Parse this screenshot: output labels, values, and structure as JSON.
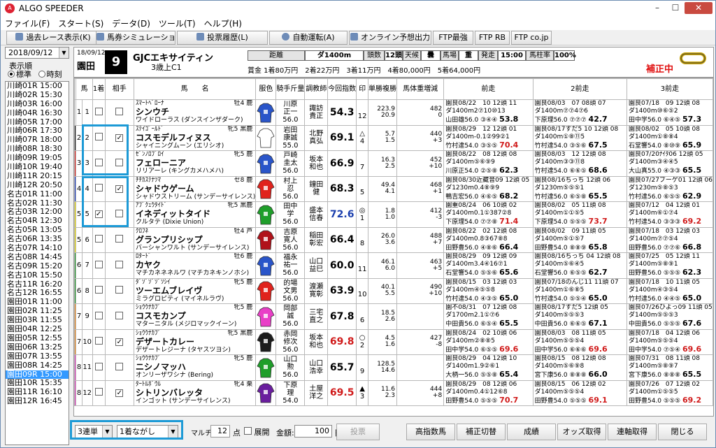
{
  "window": {
    "title": "ALGO SPEEDER",
    "min": "–",
    "max": "☐",
    "close": "✕"
  },
  "menu": [
    "ファイル(F)",
    "スタート(S)",
    "データ(D)",
    "ツール(T)",
    "ヘルプ(H)"
  ],
  "toolbar": [
    "過去レース表示(K)",
    "馬券シミュレーション(B)",
    "投票履歴(L)",
    "自動運転(A)",
    "オンライン予想出力",
    "FTP最強",
    "FTP RB",
    "FTP co.jp"
  ],
  "left": {
    "date": "2018/09/12",
    "order_label": "表示順",
    "opt_std": "標準",
    "opt_time": "時刻",
    "races": [
      "川崎01R 15:00",
      "川崎02R 15:30",
      "川崎03R 16:00",
      "川崎04R 16:30",
      "川崎05R 17:00",
      "川崎06R 17:30",
      "川崎07R 18:00",
      "川崎08R 18:30",
      "川崎09R 19:05",
      "川崎10R 19:40",
      "川崎11R 20:15",
      "川崎12R 20:50",
      "名古01R 11:00",
      "名古02R 11:30",
      "名古03R 12:00",
      "名古04R 12:30",
      "名古05R 13:05",
      "名古06R 13:35",
      "名古07R 14:10",
      "名古08R 14:45",
      "名古09R 15:20",
      "名古10R 15:50",
      "名古11R 16:20",
      "名古12R 16:55",
      "園田01R 11:00",
      "園田02R 11:25",
      "園田03R 11:55",
      "園田04R 12:25",
      "園田05R 12:55",
      "園田06R 13:25",
      "園田07R 13:55",
      "園田08R 14:25",
      "園田09R 15:00",
      "園田10R 15:35",
      "園田11R 16:10",
      "園田12R 16:45"
    ],
    "selected": 32
  },
  "race": {
    "date": "18/09/12",
    "course": "園田",
    "num": "9",
    "name": "GJCエキサイティン",
    "cls": "3歳上C1",
    "dist_lbl": "距離",
    "dist": "ダ1400m",
    "heads_lbl": "頭数",
    "heads": "12頭",
    "weather_lbl": "天候",
    "weather": "曇",
    "track_lbl": "馬場",
    "track": "重",
    "start_lbl": "発走",
    "start": "15:00",
    "rate_lbl": "馬柱率",
    "rate": "100%",
    "prize": "賞金 1着80万円　2着22万円　3着11万円　4着80,000円　5着64,000円",
    "hosei": "補正中"
  },
  "cols": [
    "馬",
    "1着",
    "相手",
    "馬　　名",
    "服色",
    "騎手斤量",
    "調教師",
    "今回指数",
    "印",
    "単勝複勝",
    "馬体重増減",
    "前走",
    "2前走",
    "3前走"
  ],
  "horses": [
    {
      "n": "1",
      "w": "1",
      "c1": "",
      "c2": "",
      "sire": "ｽﾏｰﾄﾍﾞﾛｰﾅ",
      "age": "牡4 鹿",
      "name": "シンウチ",
      "dam": "ワイドローラス (ダンスインザダーク)",
      "jk": "川原\n正一\n56.0",
      "tr": "諏訪\n貴正",
      "idx": "54.3",
      "ic": "#000",
      "mk": "\n12",
      "odds": "223.9\n20.9",
      "wt": "482\n0",
      "p1a": "園良08/22　10 12頭 11",
      "p1b": "ダ1400m2⑦10⑩13",
      "p1c": "山田雄56.0 ③④④ 53.8",
      "p2a": "園良08/03　07 08頭 07",
      "p2b": "ダ1400m⑦⑦4⑦6",
      "p2c": "下原理56.0 ⑦⑦⑦ 42.7",
      "p3a": "園良07/18　09 12頭 08",
      "p3b": "ダ1400m⑩⑥⑤2",
      "p3c": "田中学56.0 ⑥④⑤ 57.3"
    },
    {
      "n": "2",
      "w": "2",
      "c1": "",
      "c2": "✓",
      "sire": "ｽﾃｲｺﾞｰﾙﾄﾞ",
      "age": "牝5 黒鹿",
      "name": "コスモデルフィヌス",
      "dam": "シャイニングムーン (エリシオ)",
      "jk": "岩田\n康誠\n55.0",
      "tr": "北野\n真弘",
      "idx": "69.1",
      "ic": "#000",
      "mk": "△\n4",
      "odds": "5.7\n1.5",
      "wt": "440\n+3",
      "p1a": "園良08/29　12 12頭 01",
      "p1b": "ダ1400m-0.1②99②1",
      "p1c": "竹村達54.0 ③⑤⑤ 70.4",
      "p2a": "園良08/17すだ5 10 12頭 08",
      "p2b": "ダ1400m①⑧⑪5",
      "p2c": "竹村達54.0 ③⑤⑥ 67.5",
      "p3a": "園良08/02　05 10頭 08",
      "p3b": "ダ1400m①⑧⑧4",
      "p3c": "石堂響54.0 ⑧⑩⑨ 65.9"
    },
    {
      "n": "3",
      "w": "3",
      "c1": "",
      "c2": "",
      "sire": "ｾﾞﾝﾉﾛﾌﾞﾛｲ",
      "age": "牝5 鹿",
      "name": "フェローニア",
      "dam": "リリアーレ (キングカメハメハ)",
      "jk": "戸崎\n圭太\n56.0",
      "tr": "坂本\n和也",
      "idx": "66.9",
      "ic": "#000",
      "mk": "\n7",
      "odds": "16.3\n2.5",
      "wt": "452\n+10",
      "p1a": "園良08/22　08 12頭 08",
      "p1b": "ダ1400m⑤⑥⑨9",
      "p1c": "川原正54.0 ②⑤⑧ 62.3",
      "p2a": "園良08/03　12 12頭 08",
      "p2b": "ダ1400m③③⑪8",
      "p2c": "竹村達54.0 ⑥⑥⑤ 68.6",
      "p3a": "園良07/20ﾅｲﾀ06 12頭 05",
      "p3b": "ダ1400m③④④5",
      "p3c": "大山真55.0 ④③③ 65.5"
    },
    {
      "n": "4",
      "w": "4",
      "c1": "",
      "c2": "✓",
      "sire": "ﾁﾁｶｽﾃﾅﾂﾏ",
      "age": "セ8 鹿",
      "name": "シャドウゲーム",
      "dam": "シャドウストリーム (サンデーサイレンス)",
      "jk": "村上\n忍\n56.0",
      "tr": "鐘田\n健",
      "idx": "68.3",
      "ic": "#000",
      "mk": "\n5",
      "odds": "49.4\n4.1",
      "wt": "468\n+1",
      "p1a": "園良08/30近藏音09 12頭 05",
      "p1b": "ダ1230m0.4⑧⑨9",
      "p1c": "鴨吉宏56.0 ④⑥⑤ 68.2",
      "p2a": "園良08/16ちっち 12頭 06",
      "p2b": "ダ1230m⑤⑤⑤1",
      "p2c": "竹村達56.0 ⑥⑤⑧ 65.5",
      "p3a": "園良07/27ブーゲ01 12頭 06",
      "p3b": "ダ1230m⑤⑧⑤3",
      "p3c": "竹村達56.0 ⑥⑤⑤ 62.9"
    },
    {
      "n": "5",
      "w": "5",
      "c1": "✓",
      "c2": "",
      "sire": "ｱﾌﾞｸｪｳﾀｲﾄﾞ",
      "age": "牝5 黒鹿",
      "name": "イネディットタイド",
      "dam": "クルタテ (Dixie Union)",
      "jk": "田中\n学\n56.0",
      "tr": "盛本\n信春",
      "idx": "72.6",
      "ic": "#1b3fae",
      "mk": "◎\n1",
      "odds": "1.8\n1.0",
      "wt": "412\n-3",
      "p1a": "園重08/24　06 10頭 02",
      "p1b": "ダ1400m0.1①387②8",
      "p1c": "下原理54.0 ⑦⑦⑧ 71.4",
      "p2a": "園良08/02　05 11頭 08",
      "p2b": "ダ1400m①①⑤5",
      "p2c": "下原理54.0 ⑤⑤⑤ 73.7",
      "p3a": "園良07/12　04 12頭 01",
      "p3b": "ダ1400m⑥①⑦4",
      "p3c": "竹村達54.0 ③③③ 69.2"
    },
    {
      "n": "6",
      "w": "5",
      "c1": "",
      "c2": "",
      "sire": "ｸﾛﾌﾈ",
      "age": "牡4 芦",
      "name": "グランプリシップ",
      "dam": "バーシャンワルト (サンデーサイレンス)",
      "jk": "吉原\n寛人\n56.0",
      "tr": "稲田\n彰宏",
      "idx": "66.4",
      "ic": "#000",
      "mk": "\n8",
      "odds": "26.0\n3.6",
      "wt": "488\n+7",
      "p1a": "園良08/22　02 12頭 08",
      "p1b": "ダ1400m0.8③67⑧8",
      "p1c": "田野豊56.0 ④⑧⑥ 66.4",
      "p2a": "園良08/02　09 11頭 05",
      "p2b": "ダ1400m⑤①⑤7",
      "p2c": "田野豊54.0 ⑧⑧⑨ 65.8",
      "p3a": "園良07/18　03 12頭 03",
      "p3b": "ダ1400m⑦⑦⑤4",
      "p3c": "田野豊56.0 ⑦⑦⑥ 66.8"
    },
    {
      "n": "7",
      "w": "6",
      "c1": "",
      "c2": "",
      "sire": "ﾛﾀｰﾄﾞ",
      "age": "牡6 鹿",
      "name": "カヤク",
      "dam": "マチカネネネルワ (マチカネキンノホシ)",
      "jk": "福永\n祐一\n56.0",
      "tr": "山口\n益巳",
      "idx": "60.0",
      "ic": "#000",
      "mk": "\n11",
      "odds": "46.1\n6.0",
      "wt": "463\n+5",
      "p1a": "園良08/29　09 12頭 09",
      "p1b": "ダ1400m3.4④16⑦1",
      "p1c": "石堂響54.0 ⑤⑤⑥ 65.6",
      "p2a": "園良08/16ちっち 04 12頭 08",
      "p2b": "ダ1400m⑤⑥④5",
      "p2c": "石堂響56.0 ⑥⑤⑤ 62.7",
      "p3a": "園良07/25　05 12頭 11",
      "p3b": "ダ1400m⑤⑧⑨1",
      "p3c": "田野豊56.0 ⑤⑤⑤ 62.3"
    },
    {
      "n": "8",
      "w": "6",
      "c1": "",
      "c2": "",
      "sire": "ﾀﾞｿﾞｿﾞｿﾞｿｼｲ",
      "age": "牝5 鹿",
      "name": "ツーエムブレイヴ",
      "dam": "ミラグロピティ (マイネルラヴ)",
      "jk": "的場\n文男\n56.0",
      "tr": "渡瀬\n寛彰",
      "idx": "63.9",
      "ic": "#000",
      "mk": "\n10",
      "odds": "40.1\n5.5",
      "wt": "490\n+10",
      "p1a": "園良08/15　03 12頭 03",
      "p1b": "ダ1400m④⑤⑤8",
      "p1c": "竹村達54.0 ④③⑤ 65.0",
      "p2a": "園良07/18のんじ11 11頭 07",
      "p2b": "ダ1400m①⑥⑧5",
      "p2c": "竹村達54.0 ⑤⑤④ 65.0",
      "p3a": "園良07/18　10 11頭 05",
      "p3b": "ダ1400m④③⑤4",
      "p3c": "竹村達56.0 ④④⑤ 65.0"
    },
    {
      "n": "9",
      "w": "7",
      "c1": "",
      "c2": "",
      "sire": "ｼｮｳｳﾅｶﾌﾟ",
      "age": "牝5 鹿",
      "name": "コスモカンプ",
      "dam": "マターニタル (メジロマックイーン)",
      "jk": "岡部\n誠\n56.0",
      "tr": "三宅\n直之",
      "idx": "67.8",
      "ic": "#000",
      "mk": "\n6",
      "odds": "18.5\n2.6",
      "wt": "",
      "p1a": "園不08/31　07 12頭 08",
      "p1b": "ダ1700m2.1①⑦6",
      "p1c": "中田貴56.0 ⑥⑤④ 65.5",
      "p2a": "園良08/17すだ5 12頭 05",
      "p2b": "ダ1400m⑤⑤⑤3",
      "p2c": "中田貴56.0 ⑥⑥⑤ 67.1",
      "p3a": "園良07/26ひよっ09 11頭 05",
      "p3b": "ダ1400m⑤⑤⑤3",
      "p3c": "中田貴56.0 ⑤⑤⑤ 67.6"
    },
    {
      "n": "10",
      "w": "7",
      "c1": "",
      "c2": "✓",
      "sire": "ｼｮｳｳﾅｶﾌﾟ",
      "age": "牝5 黒鹿",
      "name": "デザートカレー",
      "dam": "デザートレジーナ (タヤスツヨシ)",
      "jk": "赤岡\n修次\n56.0",
      "tr": "坂本\n和也",
      "idx": "69.8",
      "ic": "#d01a1a",
      "mk": "○\n2",
      "odds": "4.5\n1.6",
      "wt": "427\n-8",
      "p1a": "園良08/24　02 10頭 06",
      "p1b": "ダ1400m②⑧⑧5",
      "p1c": "田中学54.0 ⑥⑤⑤ 69.6",
      "p2a": "園良08/03　08 11頭 05",
      "p2b": "ダ1400m⑤⑤⑤4",
      "p2c": "田中学56.0 ⑥⑥⑥ 69.6",
      "p3a": "園良07/18　04 12頭 06",
      "p3b": "ダ1400m⑤⑤⑤4",
      "p3c": "田中学54.0 ⑦⑤④ 69.6"
    },
    {
      "n": "11",
      "w": "8",
      "c1": "",
      "c2": "",
      "sire": "ｼｮｳｳﾅｶﾌﾟ",
      "age": "牝5 鹿",
      "name": "ニシノマッハ",
      "dam": "オンリーザワシナ (Bering)",
      "jk": "山口\n勲\n56.0",
      "tr": "山口\n浩幸",
      "idx": "65.7",
      "ic": "#000",
      "mk": "\n9",
      "odds": "128.5\n14.6",
      "wt": "",
      "p1a": "園良08/29　04 12頭 10",
      "p1b": "ダ1400m1.9②⑥1",
      "p1c": "大柄一56.0 ⑤⑤⑧ 65.4",
      "p2a": "園良08/15　08 12頭 08",
      "p2b": "ダ1400m⑤⑥⑨8",
      "p2c": "宮下康56.0 ⑧⑧⑧ 66.0",
      "p3a": "園良07/31　08 11頭 08",
      "p3b": "ダ1400m⑤⑧⑨7",
      "p3c": "宮下康56.0 ⑧⑧⑧ 65.5"
    },
    {
      "n": "12",
      "w": "8",
      "c1": "",
      "c2": "✓",
      "sire": "ﾀｰﾄﾙﾎﾞｳﾙ",
      "age": "牝4 栗",
      "name": "シトリンバレッタ",
      "dam": "インゴット (サンデーサイレンス)",
      "jk": "下原\n理\n54.0",
      "tr": "土屋\n洋之",
      "idx": "69.5",
      "ic": "#d01a1a",
      "mk": "▲\n3",
      "odds": "11.6\n2.3",
      "wt": "444\n+8",
      "p1a": "園良08/29　08 12頭 06",
      "p1b": "ダ1400m0.4①12⑥8",
      "p1c": "田野豊54.0 ⑤⑤⑤ 70.7",
      "p2a": "園良08/15　06 12頭 02",
      "p2b": "ダ1400m⑤⑤⑤4",
      "p2c": "田野豊54.0 ⑤⑤⑤ 69.1",
      "p3a": "園良07/26　07 12頭 02",
      "p3b": "ダ1400m①⑤⑤5",
      "p3c": "田野豊54.0 ⑤⑤⑤ 69.2"
    }
  ],
  "bottom": {
    "bet": "3連単",
    "mode": "1着ながし",
    "multi": "マルチ",
    "points": "12",
    "pts_unit": "点",
    "expand": "展開",
    "amount_lbl": "金額:",
    "amount": "100",
    "yen": "円",
    "vote": "投票",
    "b1": "高指数馬",
    "b2": "補正切替",
    "b3": "成績",
    "b4": "オッズ取得",
    "b5": "連軸取得",
    "b6": "閉じる"
  },
  "colors": {
    "w1": "#ffffff",
    "w2": "#1a1a1a",
    "w3": "#e8251f",
    "w4": "#1a3ec8",
    "w5": "#f3e300",
    "w6": "#1f9e2a",
    "w7": "#f38d1d",
    "w8": "#e93fc7",
    "highlight": "#1d9ad6"
  }
}
